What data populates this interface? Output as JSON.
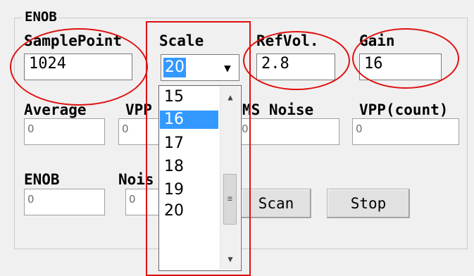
{
  "group": {
    "title": "ENOB"
  },
  "labels": {
    "sample_point": "SamplePoint",
    "scale": "Scale",
    "ref_vol": "RefVol.",
    "gain": "Gain",
    "average": "Average",
    "vpp": "VPP",
    "rms_noise": "MS Noise",
    "vpp_count": "VPP(count)",
    "enob": "ENOB",
    "noise": "Nois"
  },
  "inputs": {
    "sample_point": "1024",
    "ref_vol": "2.8",
    "gain": "16",
    "average": "0",
    "vpp": "0",
    "rms_noise": "0",
    "vpp_count": "0",
    "enob": "0",
    "noise": "0"
  },
  "scale_combo": {
    "value": "20",
    "options": [
      "15",
      "16",
      "17",
      "18",
      "19",
      "20"
    ],
    "highlighted": "16"
  },
  "buttons": {
    "scan": "Scan",
    "stop": "Stop"
  },
  "icons": {
    "dropdown_arrow": "▼",
    "scroll_up": "▲",
    "scroll_down": "▼",
    "thumb_grip": "≡"
  },
  "colors": {
    "annotation": "#e01010",
    "selection": "#3399ff"
  }
}
